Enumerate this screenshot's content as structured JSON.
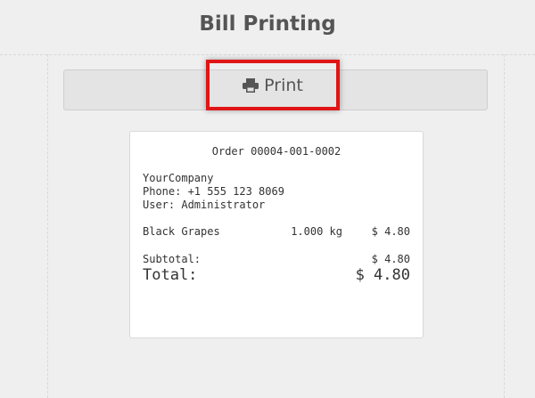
{
  "header": {
    "title": "Bill Printing"
  },
  "toolbar": {
    "print_label": "Print",
    "print_icon": "print-icon"
  },
  "receipt": {
    "order": "Order 00004-001-0002",
    "company": "YourCompany",
    "phone": "Phone: +1 555 123 8069",
    "user": "User: Administrator",
    "items": [
      {
        "name": "Black Grapes",
        "qty": "1.000 kg",
        "price": "$ 4.80"
      }
    ],
    "subtotal_label": "Subtotal:",
    "subtotal_value": "$ 4.80",
    "total_label": "Total:",
    "total_value": "$ 4.80"
  },
  "colors": {
    "highlight": "#e01515",
    "background": "#efefef"
  }
}
